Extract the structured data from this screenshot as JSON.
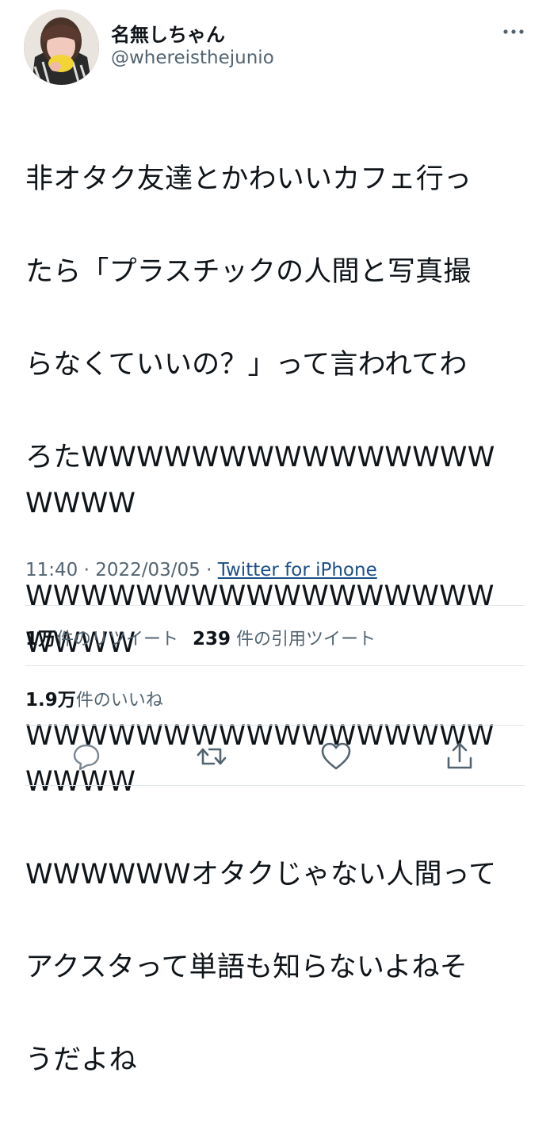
{
  "author": {
    "display_name": "名無しちゃん",
    "handle": "@whereisthejunio",
    "avatar_icon": "user-avatar"
  },
  "tweet": {
    "text": "非オタク友達とかわいいカフェ行ったら「プラスチックの人間と写真撮らなくていいの？」って言われてわろたWWWWWWWWWWWWWWWWWWWWWWWWWWWWWWWWWWWWWWWWWWWWWWWWWWWWWWWWWWWWWWWWWWWWWWWWWWWWWWWWWWWWオタクじゃない人間ってアクスタって単語も知らないよねそうだよね",
    "lines": [
      "非オタク友達とかわいいカフェ行っ",
      "たら「プラスチックの人間と写真撮",
      "らなくていいの？」って言われてわ",
      "ろたWWWWWWWWWWWWWWWWWWW",
      "WWWWWWWWWWWWWWWWWWWWW",
      "WWWWWWWWWWWWWWWWWWWWW",
      "WWWWWWオタクじゃない人間って",
      "アクスタって単語も知らないよねそ",
      "うだよね"
    ]
  },
  "meta": {
    "time": "11:40",
    "separator": " · ",
    "date": "2022/03/05",
    "source": "Twitter for iPhone"
  },
  "stats": {
    "retweets_count": "1万",
    "retweets_label": "件のリツイート",
    "quotes_count": "239",
    "quotes_label": "件の引用ツイート",
    "likes_count": "1.9万",
    "likes_label": "件のいいね"
  },
  "actions": {
    "reply_icon": "reply-icon",
    "retweet_icon": "retweet-icon",
    "like_icon": "heart-icon",
    "share_icon": "share-icon",
    "more_icon": "more-icon"
  },
  "colors": {
    "text": "#0f1419",
    "secondary": "#536471",
    "link": "#1b4f8a",
    "divider": "#e1e6ea"
  }
}
